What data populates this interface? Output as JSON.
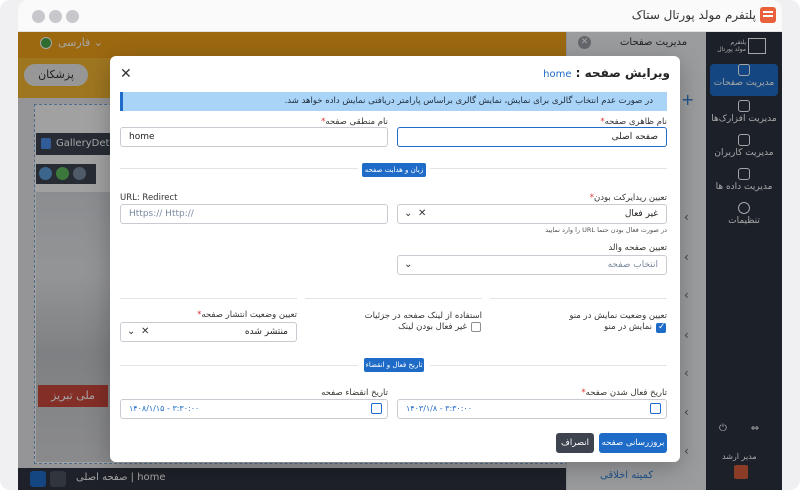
{
  "window": {
    "title": "پلتفرم مولد پورتال ستاک"
  },
  "editor": {
    "language": "فارسی",
    "doc_button": "پزشکان",
    "gallery_tag": "GalleryDetailVie",
    "photo_sign": "ملی تبریز",
    "bottom_page_name": "home",
    "bottom_page_title": "صفحه اصلی"
  },
  "pages_panel": {
    "title": "مدیریت صفحات",
    "footer_item": "کمیته اخلاقی"
  },
  "sidebar": {
    "logo_line1": "پلتفرم",
    "logo_line2": "مولد پورتال",
    "items": [
      {
        "label": "مدیریت صفحات",
        "icon": "page-icon",
        "active": true
      },
      {
        "label": "مدیریت افزارک‌ها",
        "icon": "widget-icon",
        "active": false
      },
      {
        "label": "مدیریت کاربران",
        "icon": "users-icon",
        "active": false
      },
      {
        "label": "مدیریت داده ها",
        "icon": "data-icon",
        "active": false
      },
      {
        "label": "تنظیمات",
        "icon": "gear-icon",
        "active": false
      }
    ],
    "user_role": "مدیر ارشد"
  },
  "modal": {
    "title": "ویرایش صفحه :",
    "page_key": "home",
    "alert": "در صورت عدم انتخاب گالری برای نمایش، نمایش گالری براساس پارامتر دریافتی نمایش داده خواهد شد.",
    "display_name_label": "نام ظاهری صفحه",
    "display_name_value": "صفحه  اصلی",
    "logical_name_label": "نام منطقی صفحه",
    "logical_name_value": "home",
    "section_lang": "زبان و هدایت صفحه",
    "redirect_label": "تعیین ریدایرکت بودن",
    "redirect_value": "غیر فعال",
    "redirect_hint": "در صورت فعال بودن حتما URL را وارد نمایید",
    "url_label": "URL: Redirect",
    "url_placeholder": "Https:// Http://",
    "parent_label": "تعیین صفحه والد",
    "parent_placeholder": "انتخاب صفحه",
    "menu_label": "تعیین وضعیت نمایش در منو",
    "menu_checkbox": "نمایش در منو",
    "menu_checked": true,
    "detail_link_label": "استفاده از لینک صفحه در جزئیات",
    "detail_link_checkbox": "غیر فعال بودن لینک",
    "detail_link_checked": false,
    "publish_label": "تعیین وضعیت انتشار صفحه",
    "publish_value": "منتشر شده",
    "section_dates": "تاریخ فعال و انقضاء",
    "start_date_label": "تاریخ فعال شدن صفحه",
    "start_date_value": "۱۴۰۳/۱/۸ - ۳:۳۰:۰۰",
    "end_date_label": "تاریخ انقضاء صفحه",
    "end_date_value": "۱۴۰۸/۱/۱۵ - ۳:۳۰:۰۰",
    "save_button": "بروزرسانی صفحه",
    "cancel_button": "انصراف"
  },
  "colors": {
    "primary": "#1f6cc8",
    "topbar": "#f0a21b",
    "sidebar": "#2b3340"
  }
}
